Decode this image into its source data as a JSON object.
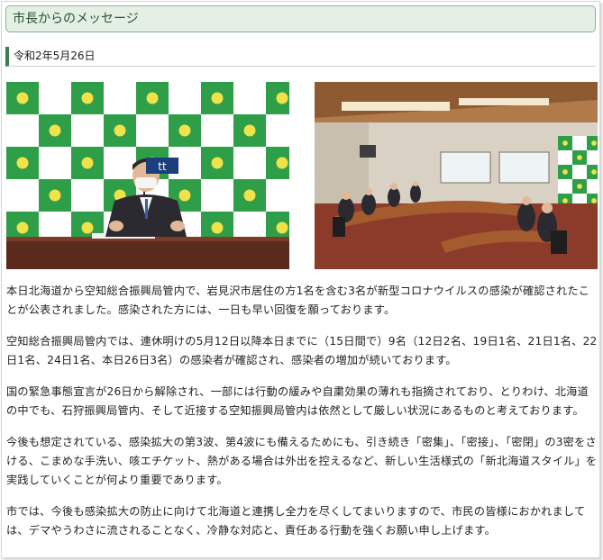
{
  "header": {
    "title": "市長からのメッセージ"
  },
  "date": "令和2年5月26日",
  "photos": {
    "left": {
      "sign_text": "tt"
    },
    "right": {}
  },
  "paragraphs": [
    "本日北海道から空知総合振興局管内で、岩見沢市居住の方1名を含む3名が新型コロナウイルスの感染が確認されたことが公表されました。感染された方には、一日も早い回復を願っております。",
    "空知総合振興局管内では、連休明けの5月12日以降本日までに（15日間で）9名（12日2名、19日1名、21日1名、22日1名、24日1名、本日26日3名）の感染者が確認され、感染者の増加が続いております。",
    "国の緊急事態宣言が26日から解除され、一部には行動の緩みや自粛効果の薄れも指摘されており、とりわけ、北海道の中でも、石狩振興局管内、そして近接する空知振興局管内は依然として厳しい状況にあるものと考えております。",
    "今後も想定されている、感染拡大の第3波、第4波にも備えるためにも、引き続き「密集」、「密接」、「密閉」の3密をさける、こまめな手洗い、咳エチケット、熱がある場合は外出を控えるなど、新しい生活様式の「新北海道スタイル」を実践していくことが何より重要であります。",
    "市では、今後も感染拡大の防止に向けて北海道と連携し全力を尽くしてまいりますので、市民の皆様におかれましては、デマやうわさに流されることなく、冷静な対応と、責任ある行動を強くお願い申し上げます。"
  ],
  "colors": {
    "header_bg": "#e4f0e5",
    "header_border": "#8dae93",
    "accent": "#3d7c4b",
    "backdrop_green": "#2f9e48"
  }
}
